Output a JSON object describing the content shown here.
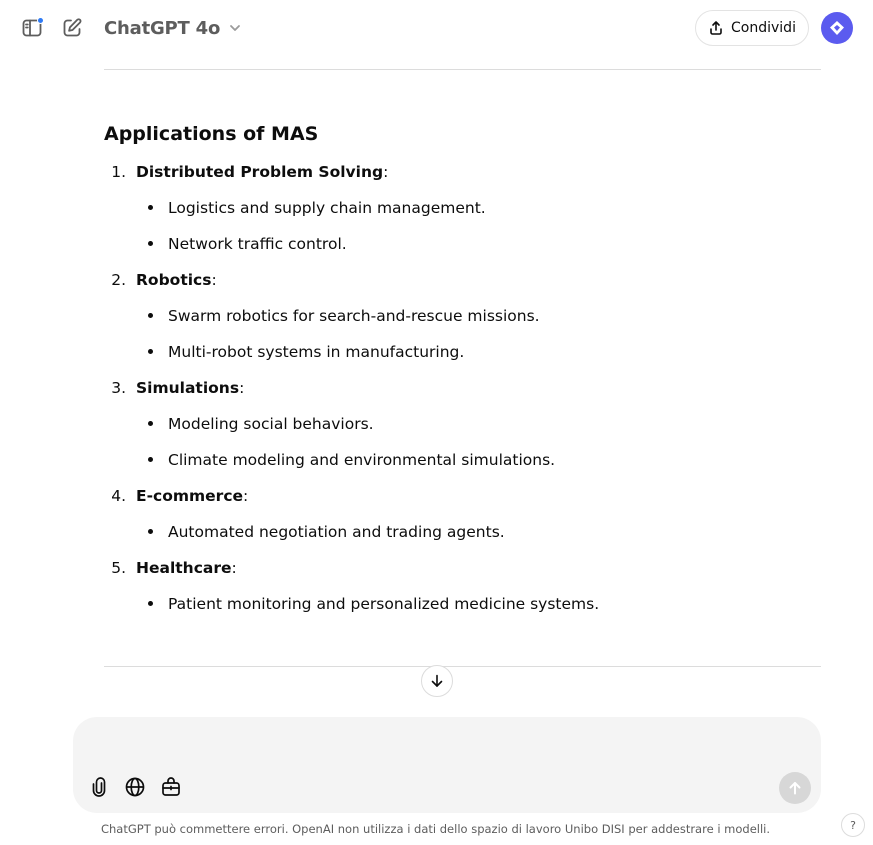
{
  "header": {
    "model_name": "ChatGPT 4o",
    "share_label": "Condividi",
    "icons": {
      "sidebar_toggle": "sidebar-icon",
      "new_chat": "edit-icon",
      "model_chevron": "chevron-down-icon",
      "share": "share-icon",
      "avatar": "diamond-logo-icon"
    },
    "notification_dot_color": "#2f7bf5",
    "avatar_color": "#5b5bef"
  },
  "message": {
    "section_title": "Applications of MAS",
    "items": [
      {
        "number": "1.",
        "title": "Distributed Problem Solving",
        "suffix": ":",
        "bullets": [
          "Logistics and supply chain management.",
          "Network traffic control."
        ]
      },
      {
        "number": "2.",
        "title": "Robotics",
        "suffix": ":",
        "bullets": [
          "Swarm robotics for search-and-rescue missions.",
          "Multi-robot systems in manufacturing."
        ]
      },
      {
        "number": "3.",
        "title": "Simulations",
        "suffix": ":",
        "bullets": [
          "Modeling social behaviors.",
          "Climate modeling and environmental simulations."
        ]
      },
      {
        "number": "4.",
        "title": "E-commerce",
        "suffix": ":",
        "bullets": [
          "Automated negotiation and trading agents."
        ]
      },
      {
        "number": "5.",
        "title": "Healthcare",
        "suffix": ":",
        "bullets": [
          "Patient monitoring and personalized medicine systems."
        ]
      }
    ]
  },
  "composer": {
    "placeholder": "",
    "icons": {
      "attach": "paperclip-icon",
      "web": "globe-icon",
      "tools": "toolbox-icon",
      "send": "arrow-up-icon",
      "scroll_down": "arrow-down-icon"
    }
  },
  "footer": {
    "disclaimer": "ChatGPT può commettere errori. OpenAI non utilizza i dati dello spazio di lavoro Unibo DISI per addestrare i modelli.",
    "help_label": "?"
  }
}
